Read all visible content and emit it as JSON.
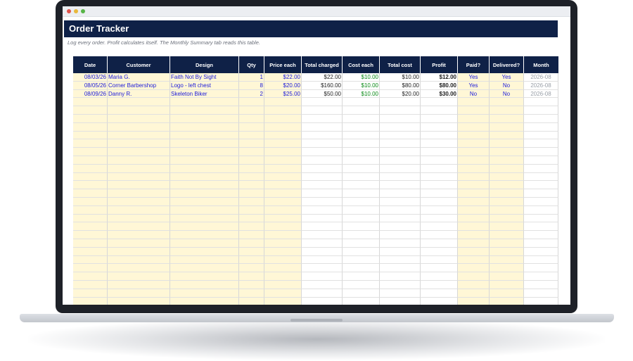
{
  "title": "Order Tracker",
  "subtitle": "Log every order. Profit calculates itself. The Monthly Summary tab reads this table.",
  "columns": [
    "Date",
    "Customer",
    "Design",
    "Qty",
    "Price each",
    "Total charged",
    "Cost each",
    "Total cost",
    "Profit",
    "Paid?",
    "Delivered?",
    "Month"
  ],
  "rows": [
    {
      "date": "08/03/26",
      "customer": "Maria G.",
      "design": "Faith Not By Sight",
      "qty": "1",
      "price": "$22.00",
      "total": "$22.00",
      "cost_each": "$10.00",
      "total_cost": "$10.00",
      "profit": "$12.00",
      "paid": "Yes",
      "delivered": "Yes",
      "month": "2026-08"
    },
    {
      "date": "08/05/26",
      "customer": "Corner Barbershop",
      "design": "Logo - left chest",
      "qty": "8",
      "price": "$20.00",
      "total": "$160.00",
      "cost_each": "$10.00",
      "total_cost": "$80.00",
      "profit": "$80.00",
      "paid": "Yes",
      "delivered": "No",
      "month": "2026-08"
    },
    {
      "date": "08/09/26",
      "customer": "Danny R.",
      "design": "Skeleton Biker",
      "qty": "2",
      "price": "$25.00",
      "total": "$50.00",
      "cost_each": "$10.00",
      "total_cost": "$20.00",
      "profit": "$30.00",
      "paid": "No",
      "delivered": "No",
      "month": "2026-08"
    }
  ],
  "colors": {
    "header_bg": "#0f2147",
    "input_cell": "#fff7d6",
    "input_text": "#1a1adb",
    "cost_text": "#0a8a16"
  }
}
